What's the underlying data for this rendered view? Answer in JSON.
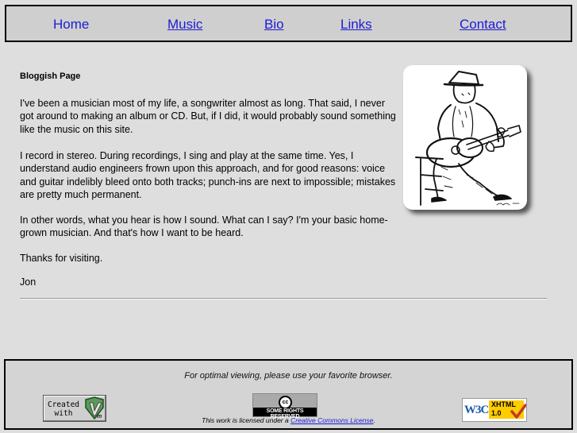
{
  "nav": {
    "items": [
      {
        "label": "Home"
      },
      {
        "label": "Music"
      },
      {
        "label": "Bio"
      },
      {
        "label": "Links"
      },
      {
        "label": "Contact"
      }
    ]
  },
  "main": {
    "title": "Bloggish Page",
    "paragraphs": [
      "I've been a musician most of my life, a songwriter almost as long. That said, I never got around to making an album or CD. But, if I did, it would probably sound something like the music on this site.",
      "I record in stereo. During recordings, I sing and play at the same time. Yes, I understand audio engineers frown upon this approach, and for good reasons: voice and guitar indelibly bleed onto both tracks; punch-ins are next to impossible; mistakes are pretty much permanent.",
      "In other words, what you hear is how I sound. What can I say? I'm your basic home-grown musician. And that's how I want to be heard.",
      "Thanks for visiting.",
      "Jon"
    ]
  },
  "footer": {
    "browser_note": "For optimal viewing, please use your favorite browser.",
    "vim_badge": {
      "line1": "Created",
      "line2": "with"
    },
    "cc_badge": {
      "symbol": "cc",
      "text": "SOME RIGHTS RESERVED"
    },
    "license_prefix": "This work is licensed under a ",
    "license_link": "Creative Commons License",
    "license_suffix": ".",
    "w3c_badge": {
      "logo": "W3C",
      "line1": "XHTML",
      "line2": "1.0"
    }
  },
  "colors": {
    "background": "#dedede",
    "nav_background": "#cfcfcf",
    "link": "#1c1cd6"
  }
}
